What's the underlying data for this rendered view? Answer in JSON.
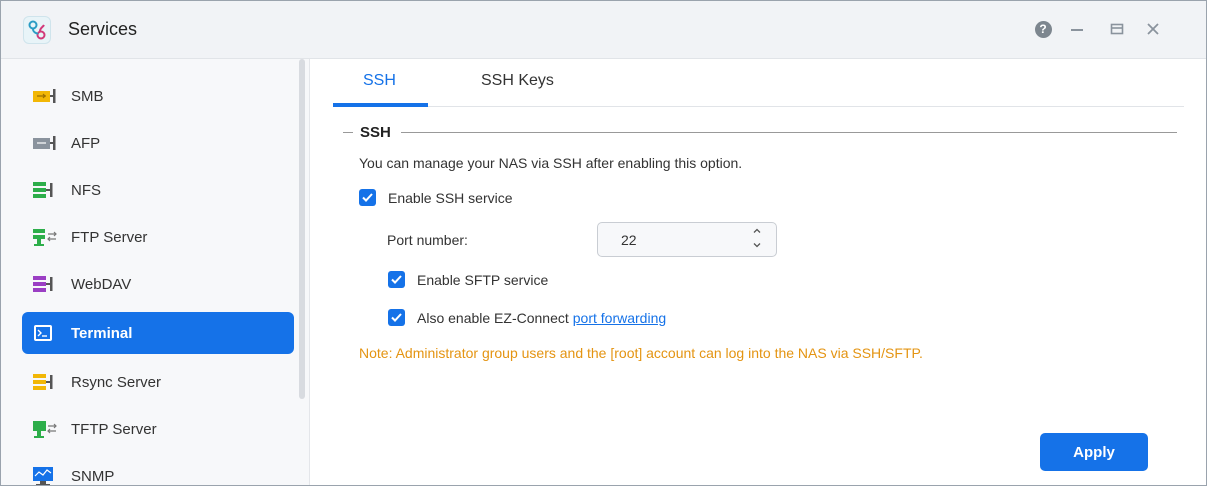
{
  "window": {
    "title": "Services",
    "app_icon": "services-icon",
    "controls": {
      "help": "?",
      "help_icon": "help-icon",
      "minimize_icon": "minimize-icon",
      "maximize_icon": "maximize-icon",
      "close_icon": "close-icon"
    }
  },
  "sidebar": {
    "items": [
      {
        "label": "SMB",
        "icon": "smb-icon",
        "color": "#f2b705"
      },
      {
        "label": "AFP",
        "icon": "afp-icon",
        "color": "#8a939d"
      },
      {
        "label": "NFS",
        "icon": "nfs-icon",
        "color": "#2dae4a"
      },
      {
        "label": "FTP Server",
        "icon": "ftp-server-icon",
        "color": "#2dae4a"
      },
      {
        "label": "WebDAV",
        "icon": "webdav-icon",
        "color": "#9b3fc4"
      },
      {
        "label": "Terminal",
        "icon": "terminal-icon",
        "active": true
      },
      {
        "label": "Rsync Server",
        "icon": "rsync-server-icon",
        "color": "#f2b705"
      },
      {
        "label": "TFTP Server",
        "icon": "tftp-server-icon",
        "color": "#2dae4a"
      },
      {
        "label": "SNMP",
        "icon": "snmp-icon",
        "color": "#1572e8"
      }
    ]
  },
  "tabs": [
    {
      "label": "SSH",
      "active": true
    },
    {
      "label": "SSH Keys",
      "active": false
    }
  ],
  "ssh": {
    "section_title": "SSH",
    "description": "You can manage your NAS via SSH after enabling this option.",
    "enable_ssh_label": "Enable SSH service",
    "enable_ssh_checked": true,
    "port_label": "Port number:",
    "port_value": "22",
    "enable_sftp_label": "Enable SFTP service",
    "enable_sftp_checked": true,
    "ez_connect_label": "Also enable EZ-Connect",
    "ez_connect_link": "port forwarding",
    "ez_connect_checked": true,
    "note": "Note: Administrator group users and the [root] account can log into the NAS via SSH/SFTP."
  },
  "actions": {
    "apply_label": "Apply"
  },
  "colors": {
    "accent": "#1572e8",
    "note": "#e49412"
  }
}
